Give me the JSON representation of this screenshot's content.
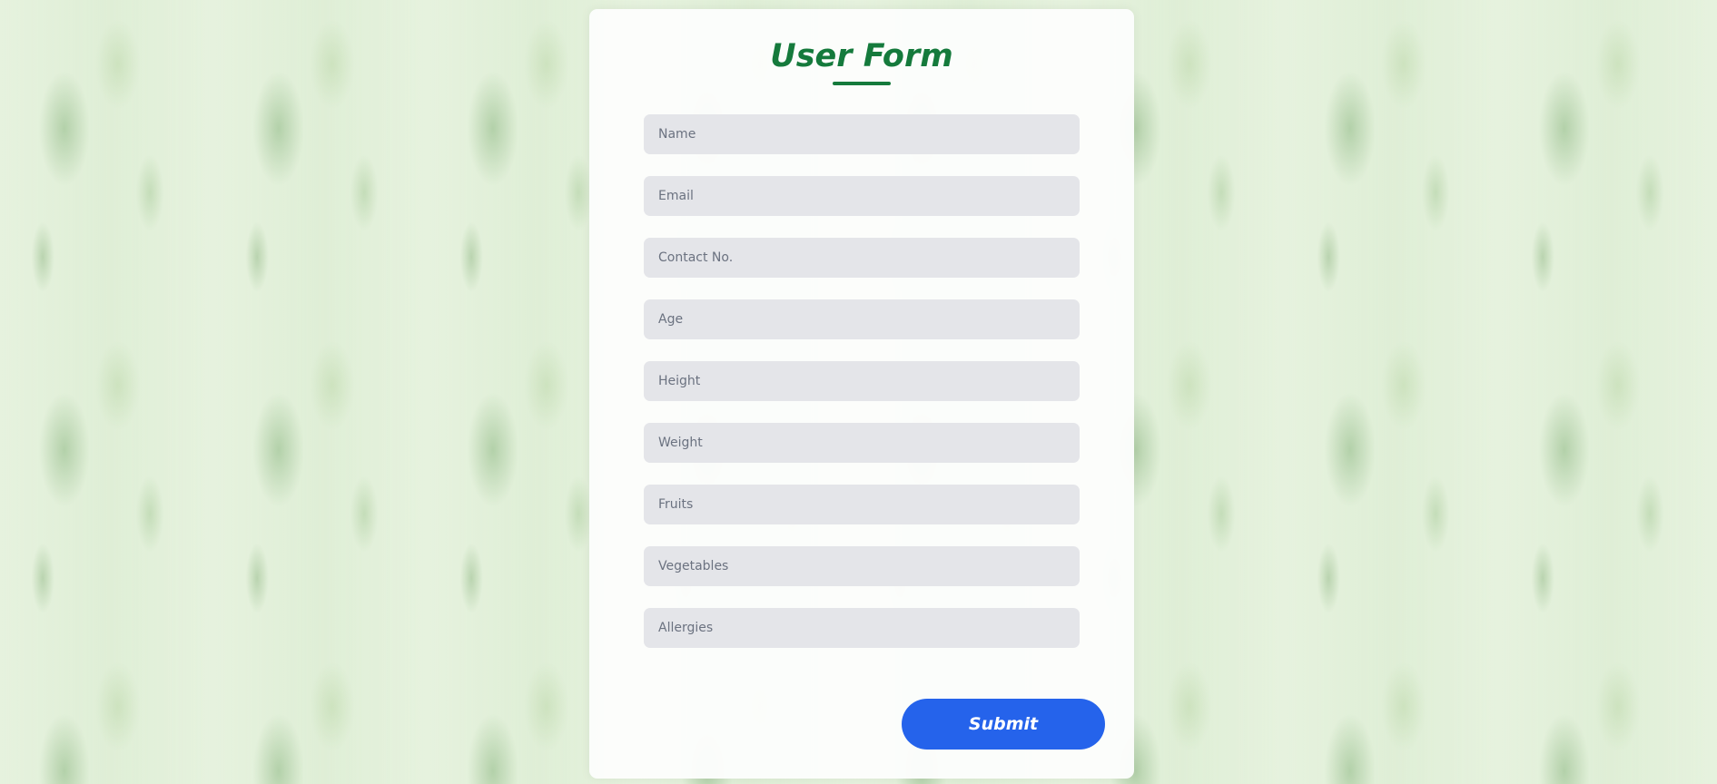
{
  "form": {
    "title": "User Form",
    "fields": [
      {
        "placeholder": "Name",
        "value": ""
      },
      {
        "placeholder": "Email",
        "value": ""
      },
      {
        "placeholder": "Contact No.",
        "value": ""
      },
      {
        "placeholder": "Age",
        "value": ""
      },
      {
        "placeholder": "Height",
        "value": ""
      },
      {
        "placeholder": "Weight",
        "value": ""
      },
      {
        "placeholder": "Fruits",
        "value": ""
      },
      {
        "placeholder": "Vegetables",
        "value": ""
      },
      {
        "placeholder": "Allergies",
        "value": ""
      }
    ],
    "submit_label": "Submit"
  },
  "colors": {
    "title": "#157a3c",
    "submit_bg": "#2563eb",
    "field_bg": "#e4e5e9",
    "background": "#e6f2de"
  }
}
